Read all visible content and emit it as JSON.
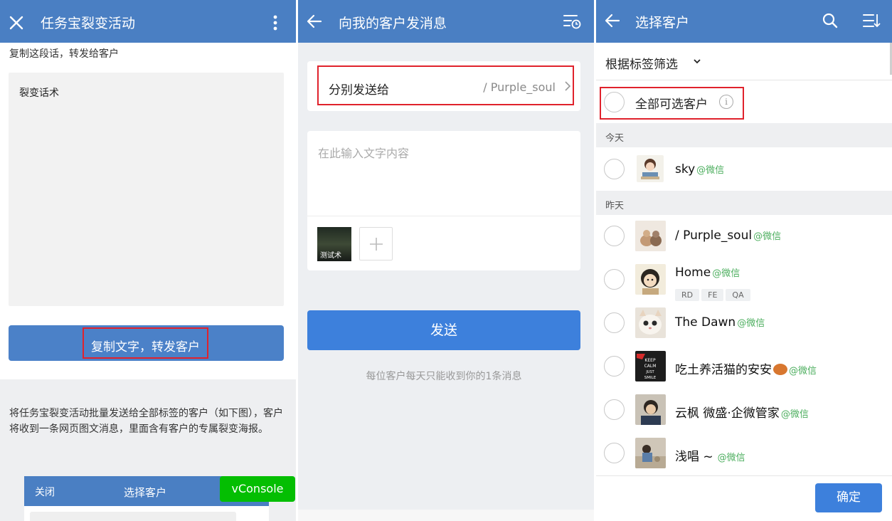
{
  "panel1": {
    "title": "任务宝裂变活动",
    "hint": "复制这段话，转发给客户",
    "textarea_label": "裂变话术",
    "copy_button": "复制文字，转发客户",
    "description": "将任务宝裂变活动批量发送给全部标签的客户（如下图），客户将收到一条网页图文消息，里面含有客户的专属裂变海报。",
    "mini_close": "关闭",
    "mini_title": "选择客户",
    "vconsole": "vConsole"
  },
  "panel2": {
    "title": "向我的客户发消息",
    "send_to_label": "分别发送给",
    "send_to_value": "/ Purple_soul",
    "input_placeholder": "在此输入文字内容",
    "thumb_text": "测试术",
    "send_button": "发送",
    "note": "每位客户每天只能收到你的1条消息"
  },
  "panel3": {
    "title": "选择客户",
    "filter": "根据标签筛选",
    "all_label": "全部可选客户",
    "section_today": "今天",
    "section_yesterday": "昨天",
    "wechat": "@微信",
    "customers": [
      {
        "name": "sky",
        "tags": []
      },
      {
        "name": " / Purple_soul",
        "tags": []
      },
      {
        "name": "Home",
        "tags": [
          "RD",
          "FE",
          "QA"
        ]
      },
      {
        "name": "The Dawn",
        "tags": []
      },
      {
        "name": "吃土养活猫的安安",
        "tags": []
      },
      {
        "name": "云枫 微盛·企微管家",
        "tags": []
      },
      {
        "name": "浅唱 ~",
        "tags": []
      }
    ],
    "confirm": "确定"
  },
  "colors": {
    "header": "#4a7fc3",
    "primary_button": "#3d80dc",
    "highlight_box": "#e0222c",
    "wechat_green": "#4cae5e",
    "vconsole_green": "#04be02"
  },
  "icons": [
    "close-icon",
    "more-vertical-icon",
    "back-arrow-icon",
    "schedule-list-icon",
    "chevron-right-icon",
    "plus-icon",
    "search-icon",
    "sort-list-icon",
    "chevron-down-icon",
    "info-icon"
  ]
}
